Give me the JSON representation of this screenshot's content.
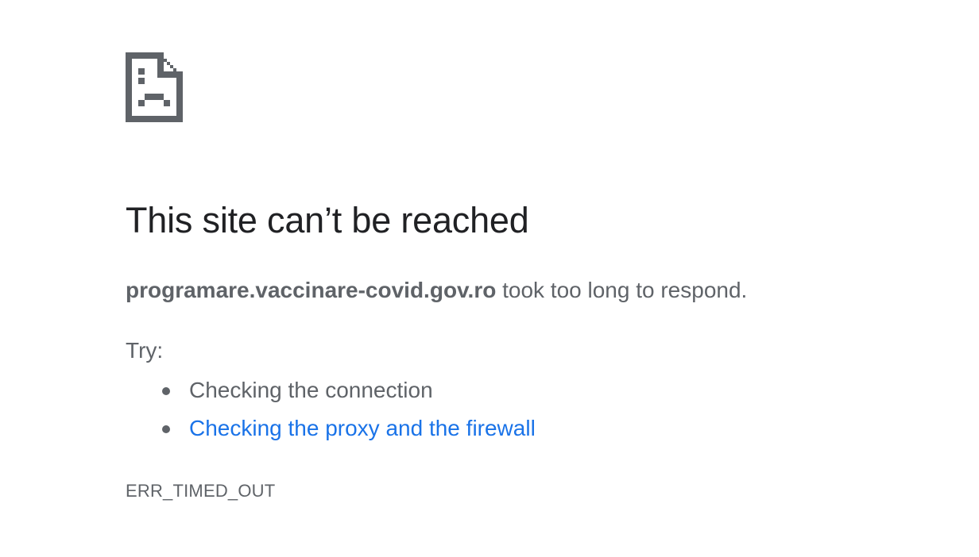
{
  "icon": "sad-page-icon",
  "heading": "This site can’t be reached",
  "summary": {
    "host": "programare.vaccinare-covid.gov.ro",
    "message": " took too long to respond."
  },
  "try_label": "Try:",
  "suggestions": [
    {
      "text": "Checking the connection",
      "is_link": false
    },
    {
      "text": "Checking the proxy and the firewall",
      "is_link": true
    }
  ],
  "error_code": "ERR_TIMED_OUT",
  "colors": {
    "heading": "#202124",
    "text": "#5f6368",
    "link": "#1a73e8",
    "background": "#ffffff"
  }
}
